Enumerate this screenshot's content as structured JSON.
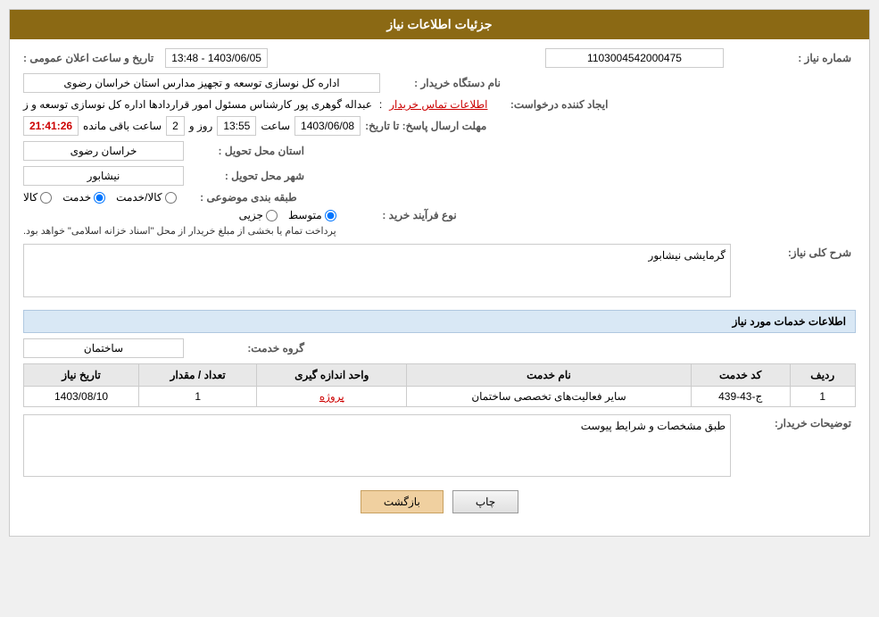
{
  "page": {
    "title": "جزئیات اطلاعات نیاز",
    "header_bg": "#8B6914"
  },
  "fields": {
    "need_number_label": "شماره نیاز :",
    "need_number_value": "1103004542000475",
    "buyer_org_label": "نام دستگاه خریدار :",
    "buyer_org_value": "اداره کل نوسازی  توسعه و تجهیز مدارس استان خراسان رضوی",
    "creator_label": "ایجاد کننده درخواست:",
    "creator_value": "عبداله گوهری پور کارشناس مسئول امور قراردادها  اداره کل نوسازی  توسعه و ز",
    "creator_link": "اطلاعات تماس خریدار",
    "response_deadline_label": "مهلت ارسال پاسخ: تا تاریخ:",
    "response_date": "1403/06/08",
    "response_time_label": "ساعت",
    "response_time": "13:55",
    "response_day_label": "روز و",
    "response_days": "2",
    "response_remaining_label": "ساعت باقی مانده",
    "response_remaining": "21:41:26",
    "province_label": "استان محل تحویل :",
    "province_value": "خراسان رضوی",
    "city_label": "شهر محل تحویل :",
    "city_value": "نیشابور",
    "category_label": "طبقه بندی موضوعی :",
    "category_options": [
      "کالا",
      "خدمت",
      "کالا/خدمت"
    ],
    "category_selected": "خدمت",
    "purchase_type_label": "نوع فرآیند خرید :",
    "purchase_type_note": "پرداخت تمام یا بخشی از مبلغ خریدار از محل \"اسناد خزانه اسلامی\" خواهد بود.",
    "purchase_types": [
      "جزیی",
      "متوسط"
    ],
    "purchase_selected": "متوسط",
    "general_desc_label": "شرح کلی نیاز:",
    "general_desc_value": "گرمایشی نیشابور",
    "services_section_label": "اطلاعات خدمات مورد نیاز",
    "service_group_label": "گروه خدمت:",
    "service_group_value": "ساختمان",
    "table": {
      "headers": [
        "ردیف",
        "کد خدمت",
        "نام خدمت",
        "واحد اندازه گیری",
        "تعداد / مقدار",
        "تاریخ نیاز"
      ],
      "rows": [
        {
          "row": "1",
          "code": "ج-43-439",
          "name": "سایر فعالیت‌های تخصصی ساختمان",
          "unit": "پروژه",
          "quantity": "1",
          "date": "1403/08/10"
        }
      ]
    },
    "buyer_desc_label": "توضیحات خریدار:",
    "buyer_desc_value": "طبق مشخصات و شرایط پیوست",
    "announce_datetime_label": "تاریخ و ساعت اعلان عمومی :",
    "announce_date": "1403/06/05",
    "announce_time": "13:48",
    "buttons": {
      "print": "چاپ",
      "back": "بازگشت"
    }
  }
}
